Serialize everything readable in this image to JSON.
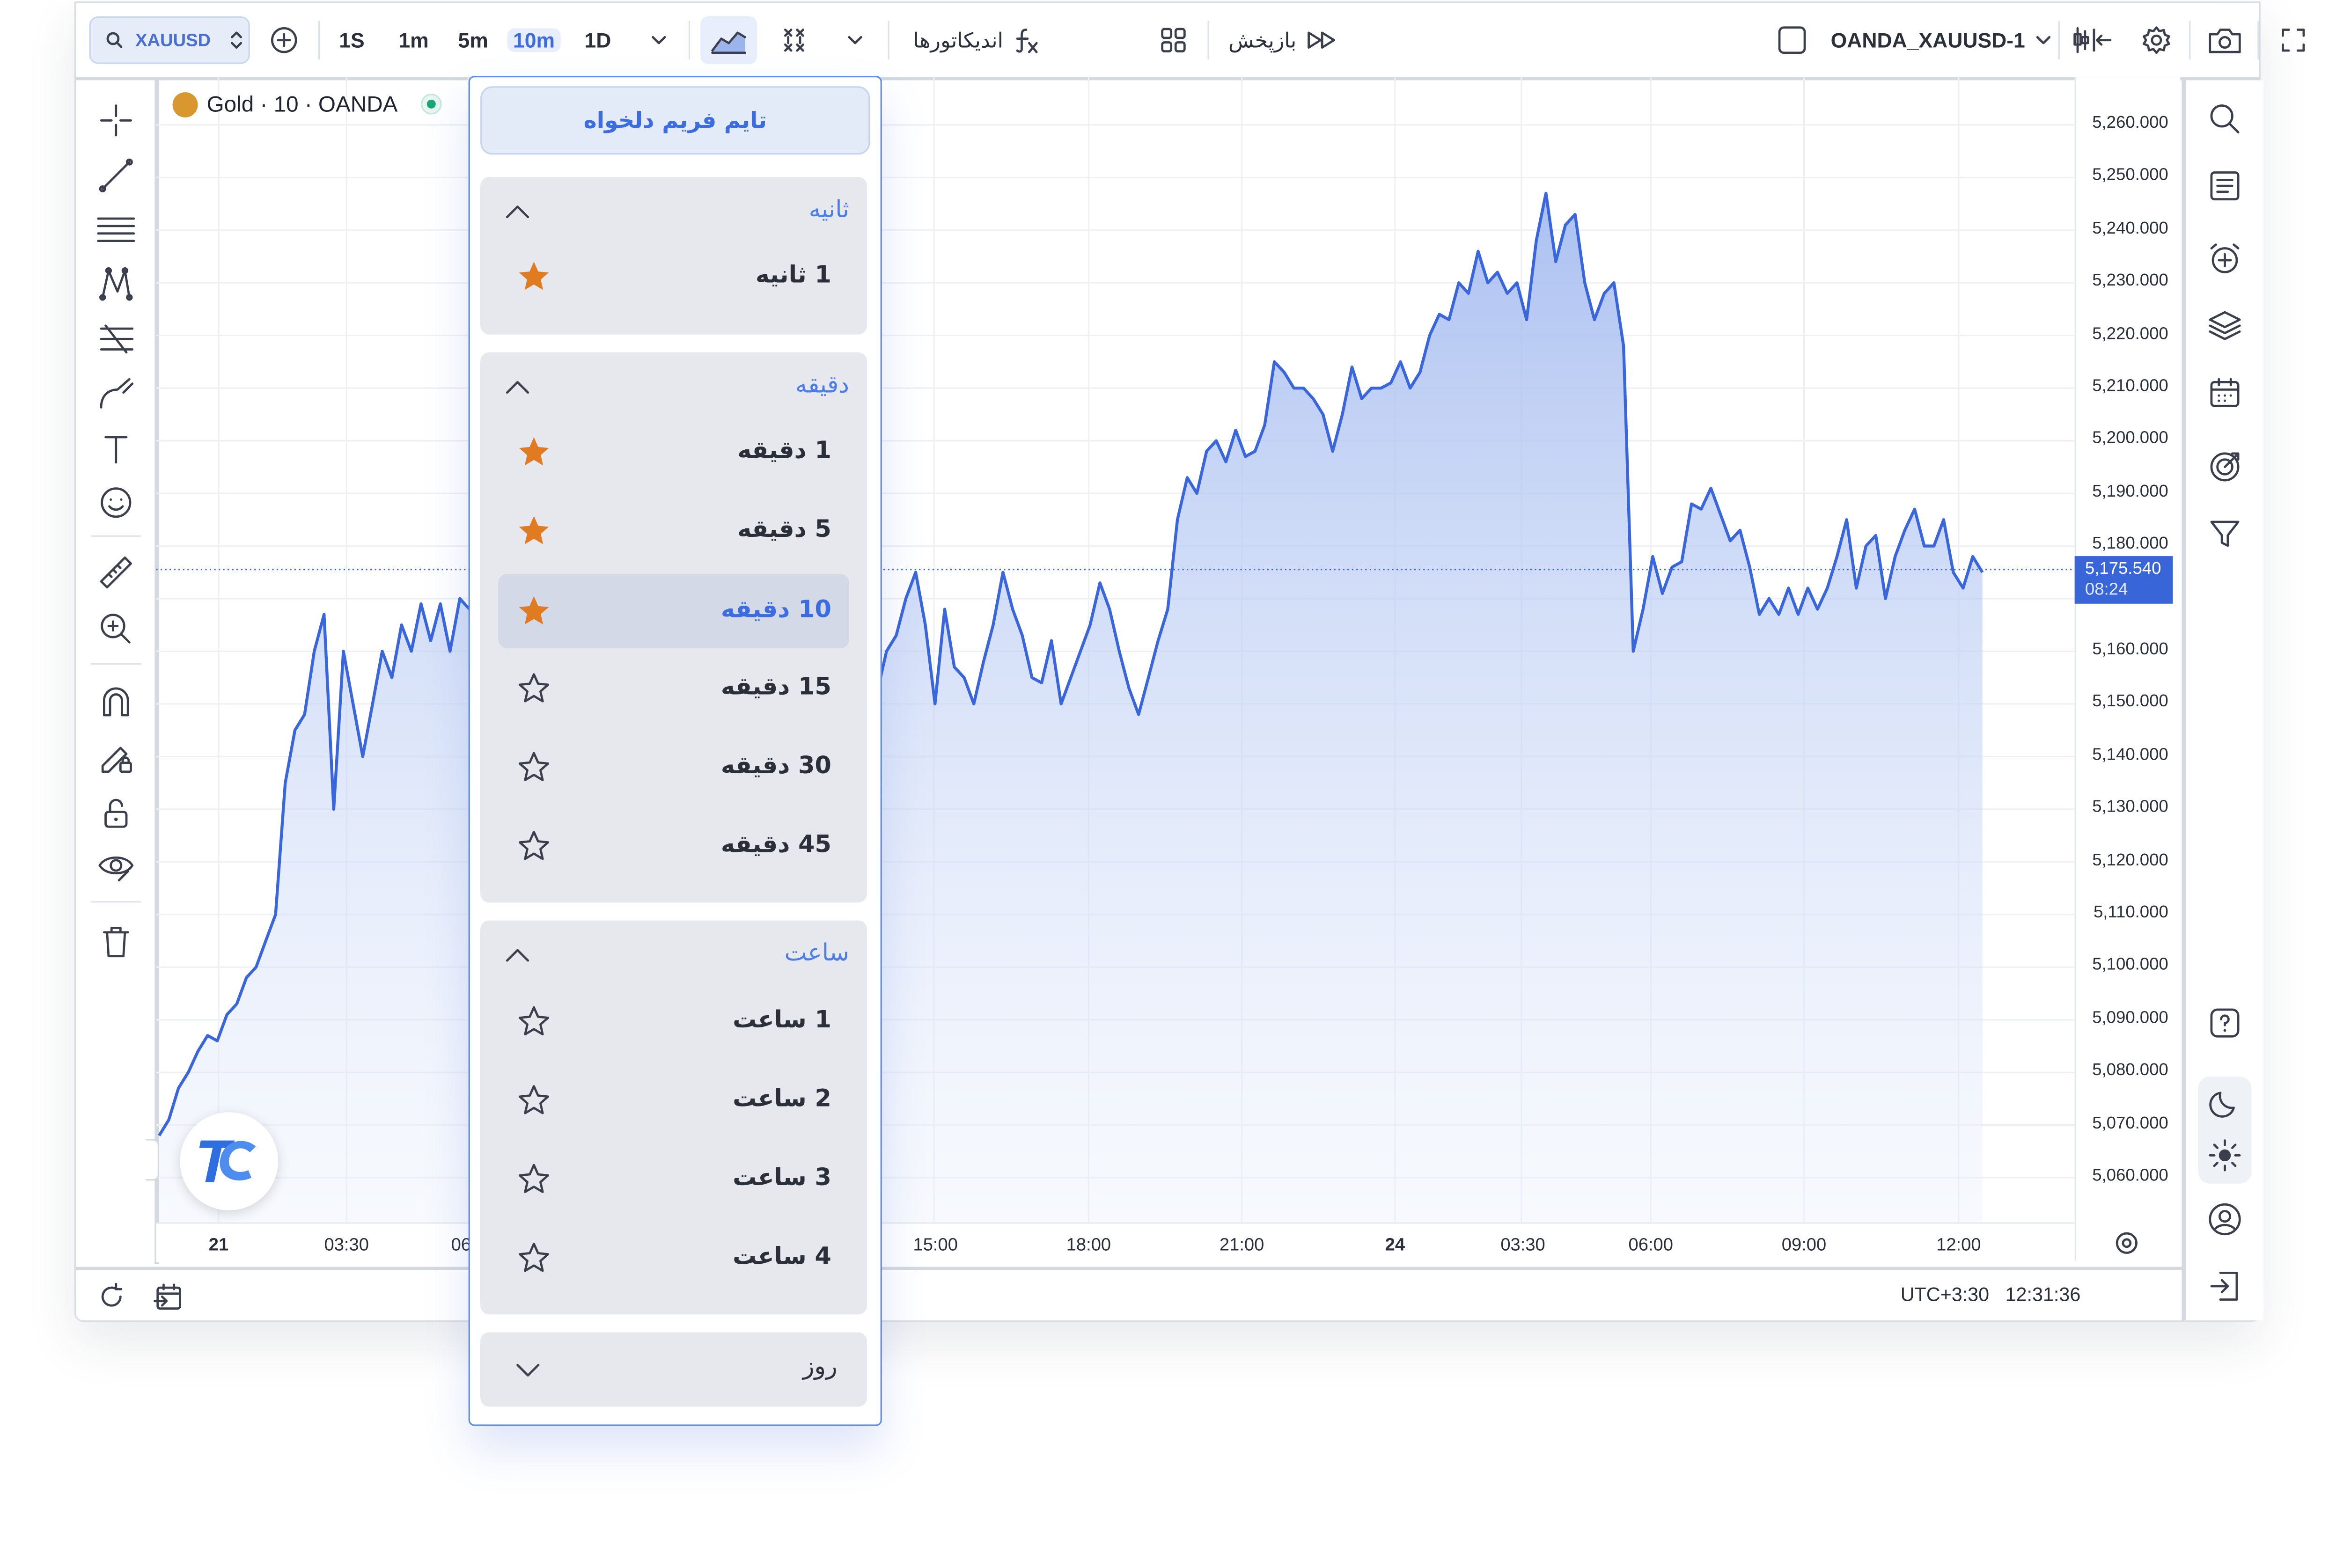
{
  "toolbar": {
    "symbol": "XAUUSD",
    "timeframes": [
      "1S",
      "1m",
      "5m",
      "10m",
      "1D"
    ],
    "indicators_label": "اندیکاتورها",
    "replay_label": "بازپخش",
    "account": "OANDA_XAUUSD-1"
  },
  "legend": {
    "text": "Gold · 10 · OANDA"
  },
  "dropdown": {
    "custom_label": "تایم فریم دلخواه",
    "groups": [
      {
        "name": "ثانیه",
        "items": [
          {
            "label": "1 ثانیه",
            "starred": true
          }
        ]
      },
      {
        "name": "دقیقه",
        "items": [
          {
            "label": "1 دقیقه",
            "starred": true
          },
          {
            "label": "5 دقیقه",
            "starred": true
          },
          {
            "label": "10 دقیقه",
            "starred": true,
            "selected": true
          },
          {
            "label": "15 دقیقه",
            "starred": false
          },
          {
            "label": "30 دقیقه",
            "starred": false
          },
          {
            "label": "45 دقیقه",
            "starred": false
          }
        ]
      },
      {
        "name": "ساعت",
        "items": [
          {
            "label": "1 ساعت",
            "starred": false
          },
          {
            "label": "2 ساعت",
            "starred": false
          },
          {
            "label": "3 ساعت",
            "starred": false
          },
          {
            "label": "4 ساعت",
            "starred": false
          }
        ]
      }
    ],
    "collapsed_group": "روز"
  },
  "status": {
    "timezone": "UTC+3:30",
    "time": "12:31:36"
  },
  "colors": {
    "accent": "#3b6ce0",
    "line": "#3a66dd",
    "star": "#e07b22",
    "price_tag": "#3866d8"
  },
  "chart_data": {
    "type": "area",
    "y_ticks": [
      "5,260.000",
      "5,250.000",
      "5,240.000",
      "5,230.000",
      "5,220.000",
      "5,210.000",
      "5,200.000",
      "5,190.000",
      "5,180.000",
      "5,160.000",
      "5,150.000",
      "5,140.000",
      "5,130.000",
      "5,120.000",
      "5,110.000",
      "5,100.000",
      "5,090.000",
      "5,080.000",
      "5,070.000",
      "5,060.000"
    ],
    "x_ticks": [
      {
        "label": "21",
        "bold": true
      },
      {
        "label": "03:30"
      },
      {
        "label": "06"
      },
      {
        "label": "15:00"
      },
      {
        "label": "18:00"
      },
      {
        "label": "21:00"
      },
      {
        "label": "24",
        "bold": true
      },
      {
        "label": "03:30"
      },
      {
        "label": "06:00"
      },
      {
        "label": "09:00"
      },
      {
        "label": "12:00"
      }
    ],
    "last_price": "5,175.540",
    "countdown": "08:24",
    "ylim": [
      5055,
      5265
    ],
    "values": [
      5068,
      5071,
      5077,
      5080,
      5084,
      5087,
      5086,
      5091,
      5093,
      5098,
      5100,
      5105,
      5110,
      5135,
      5145,
      5148,
      5160,
      5167,
      5130,
      5160,
      5150,
      5140,
      5150,
      5160,
      5155,
      5165,
      5160,
      5169,
      5162,
      5169,
      5160,
      5170,
      5168,
      5172,
      5165,
      5175,
      5170,
      5168,
      5162,
      5160,
      5165,
      5162,
      5153,
      5150,
      5158,
      5153,
      5162,
      5160,
      5158,
      5152,
      5155,
      5162,
      5152,
      5150,
      5152,
      5165,
      5162,
      5150,
      5158,
      5160,
      5155,
      5163,
      5167,
      5160,
      5157,
      5150,
      5148,
      5152,
      5158,
      5160,
      5162,
      5150,
      5158,
      5156,
      5152,
      5160,
      5163,
      5170,
      5175,
      5165,
      5150,
      5168,
      5157,
      5155,
      5150,
      5158,
      5165,
      5175,
      5168,
      5163,
      5155,
      5154,
      5162,
      5150,
      5155,
      5160,
      5165,
      5173,
      5168,
      5160,
      5153,
      5148,
      5155,
      5162,
      5168,
      5185,
      5193,
      5190,
      5198,
      5200,
      5196,
      5202,
      5197,
      5198,
      5203,
      5215,
      5213,
      5210,
      5210,
      5208,
      5205,
      5198,
      5205,
      5214,
      5208,
      5210,
      5210,
      5211,
      5215,
      5210,
      5213,
      5220,
      5224,
      5223,
      5230,
      5228,
      5236,
      5230,
      5232,
      5228,
      5230,
      5223,
      5238,
      5247,
      5234,
      5241,
      5243,
      5230,
      5223,
      5228,
      5230,
      5218,
      5160,
      5168,
      5178,
      5171,
      5176,
      5177,
      5188,
      5187,
      5191,
      5186,
      5181,
      5183,
      5176,
      5167,
      5170,
      5167,
      5172,
      5167,
      5172,
      5168,
      5172,
      5178,
      5185,
      5172,
      5180,
      5182,
      5170,
      5178,
      5183,
      5187,
      5180,
      5180,
      5185,
      5175,
      5172,
      5178,
      5175
    ]
  }
}
